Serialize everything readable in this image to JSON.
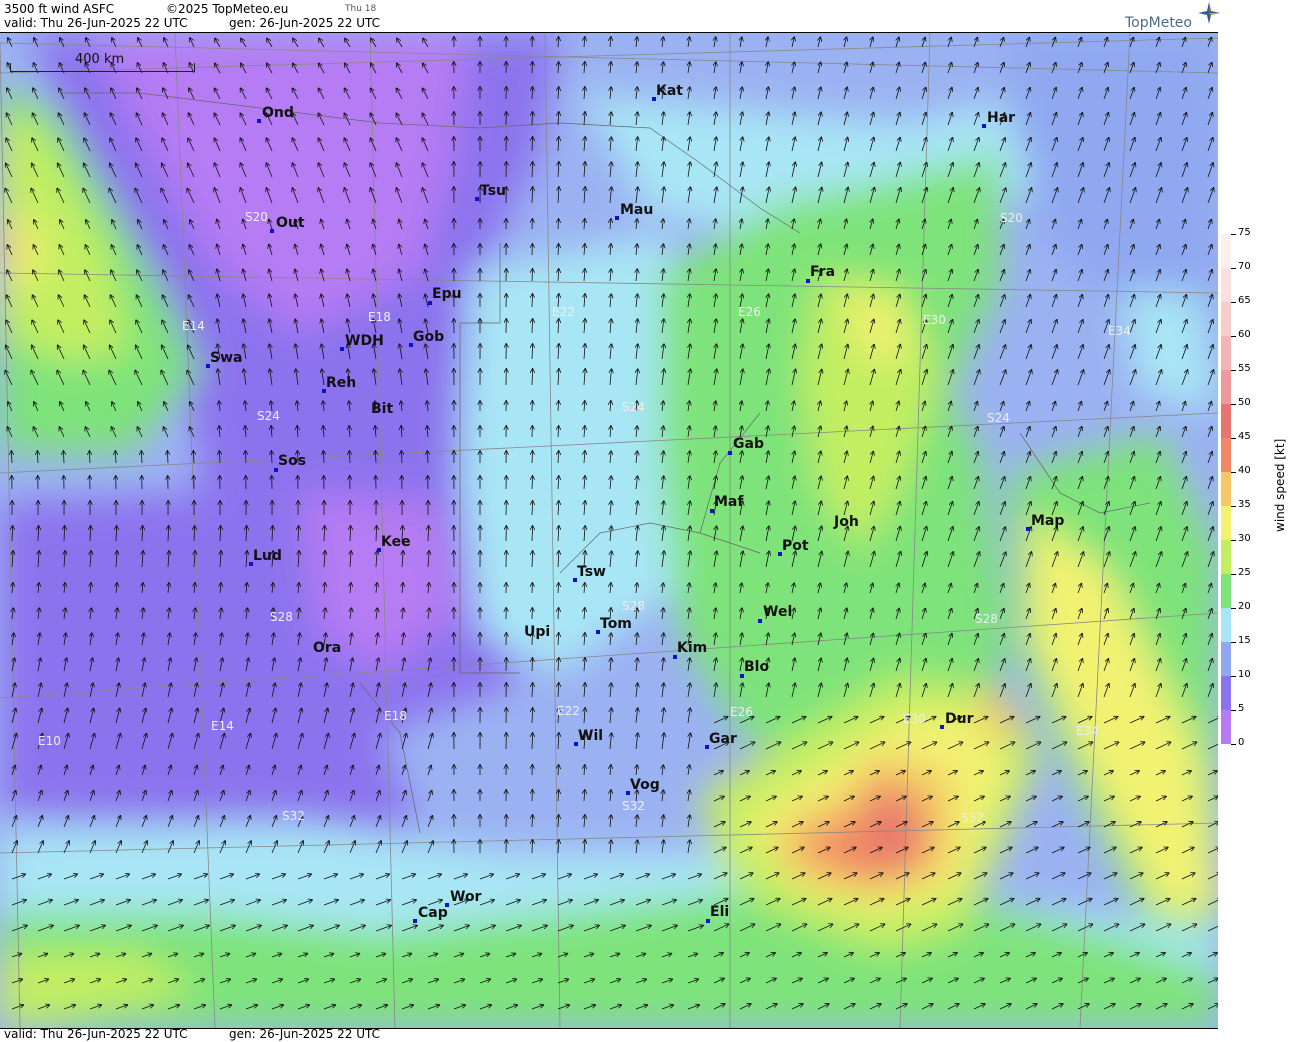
{
  "header": {
    "product": "3500 ft wind ASFC",
    "copyright": "©2025 TopMeteo.eu",
    "day_small": "Thu 18",
    "valid": "valid:  Thu  26-Jun-2025  22 UTC",
    "gen": "gen: 26-Jun-2025 22 UTC"
  },
  "logo": {
    "text": "TopMeteo",
    "icon": "compass-star-icon"
  },
  "scalebar": {
    "label": "400 km"
  },
  "footer": {
    "valid": "valid:  Thu  26-Jun-2025  22 UTC",
    "gen": "gen: 26-Jun-2025 22 UTC"
  },
  "legend": {
    "title": "wind speed  [kt]",
    "levels": [
      "0",
      "5",
      "10",
      "15",
      "20",
      "25",
      "30",
      "35",
      "40",
      "45",
      "50",
      "55",
      "60",
      "65",
      "70",
      "75"
    ],
    "colors": [
      "#b57cf3",
      "#8c73ee",
      "#8fa8f0",
      "#a8e6f5",
      "#7ee37a",
      "#c3ee62",
      "#f2f272",
      "#f4c866",
      "#f08866",
      "#e67471",
      "#ee9a9c",
      "#f3b4b6",
      "#f6cdcd",
      "#f9e0e0",
      "#fcefef",
      "#ffffff"
    ]
  },
  "cities": [
    {
      "name": "Kat"
    },
    {
      "name": "Ond"
    },
    {
      "name": "Har"
    },
    {
      "name": "Tsu"
    },
    {
      "name": "Mau"
    },
    {
      "name": "Out"
    },
    {
      "name": "Fra"
    },
    {
      "name": "Epu"
    },
    {
      "name": "Gob"
    },
    {
      "name": "WDH"
    },
    {
      "name": "Swa"
    },
    {
      "name": "Reh"
    },
    {
      "name": "Bit"
    },
    {
      "name": "Gab"
    },
    {
      "name": "Sos"
    },
    {
      "name": "Maf"
    },
    {
      "name": "Map"
    },
    {
      "name": "Joh"
    },
    {
      "name": "Pot"
    },
    {
      "name": "Kee"
    },
    {
      "name": "Lud"
    },
    {
      "name": "Tsw"
    },
    {
      "name": "Wel"
    },
    {
      "name": "Tom"
    },
    {
      "name": "Upi"
    },
    {
      "name": "Kim"
    },
    {
      "name": "Ora"
    },
    {
      "name": "Blo"
    },
    {
      "name": "Dur"
    },
    {
      "name": "Wil"
    },
    {
      "name": "Gar"
    },
    {
      "name": "Vog"
    },
    {
      "name": "Wor"
    },
    {
      "name": "Cap"
    },
    {
      "name": "Eli"
    }
  ],
  "grid_labels": [
    "S20",
    "S20",
    "E14",
    "E18",
    "E22",
    "E26",
    "E30",
    "E34",
    "S24",
    "S24",
    "S24",
    "S28",
    "S28",
    "S28",
    "E10",
    "E14",
    "E18",
    "E22",
    "E26",
    "E30",
    "E34",
    "S32",
    "S32",
    "S32"
  ]
}
